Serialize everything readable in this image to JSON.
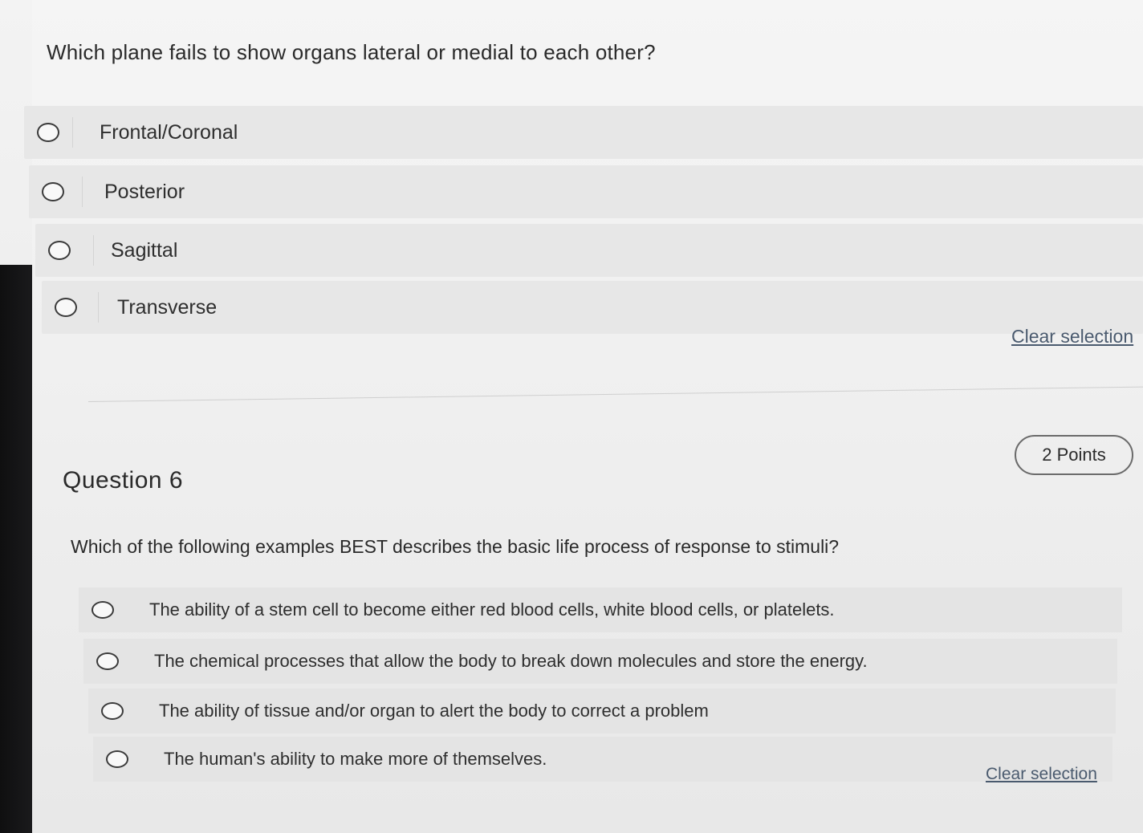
{
  "question5": {
    "text": "Which plane fails to show organs lateral or medial to each other?",
    "options": [
      {
        "label": "Frontal/Coronal"
      },
      {
        "label": "Posterior"
      },
      {
        "label": "Sagittal"
      },
      {
        "label": "Transverse"
      }
    ],
    "clear_label": "Clear selection"
  },
  "question6": {
    "heading": "Question 6",
    "points": "2 Points",
    "text": "Which of the following examples BEST describes the basic life process of response to stimuli?",
    "options": [
      {
        "label": "The ability of a stem cell to become either red blood cells, white blood cells, or platelets."
      },
      {
        "label": "The chemical processes that allow the body to break down molecules and store the energy."
      },
      {
        "label": "The ability of tissue and/or organ to alert the body to correct a problem"
      },
      {
        "label": "The human's ability to make more of themselves."
      }
    ],
    "clear_label": "Clear selection"
  }
}
